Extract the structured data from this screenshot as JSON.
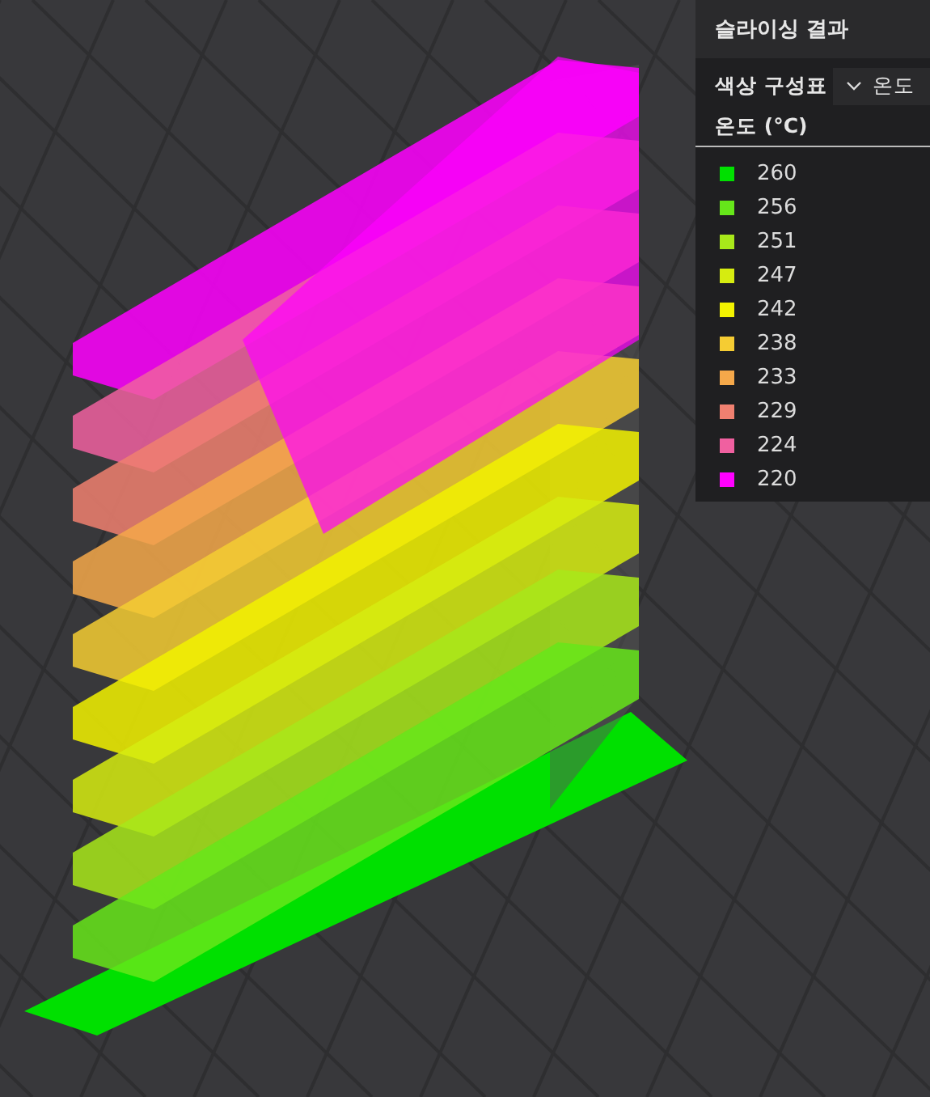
{
  "results_panel": {
    "title": "슬라이싱 결과",
    "color_scheme": {
      "label": "색상 구성표",
      "value": "온도"
    },
    "legend": {
      "title": "온도 (°C)",
      "items": [
        {
          "label": "260",
          "color": "#00e000"
        },
        {
          "label": "256",
          "color": "#66e61a"
        },
        {
          "label": "251",
          "color": "#a8e81a"
        },
        {
          "label": "247",
          "color": "#d6ec10"
        },
        {
          "label": "242",
          "color": "#f2f200"
        },
        {
          "label": "238",
          "color": "#f5cc33"
        },
        {
          "label": "233",
          "color": "#f5a84a"
        },
        {
          "label": "229",
          "color": "#f08070"
        },
        {
          "label": "224",
          "color": "#f060a0"
        },
        {
          "label": "220",
          "color": "#ff00ff"
        }
      ]
    }
  }
}
